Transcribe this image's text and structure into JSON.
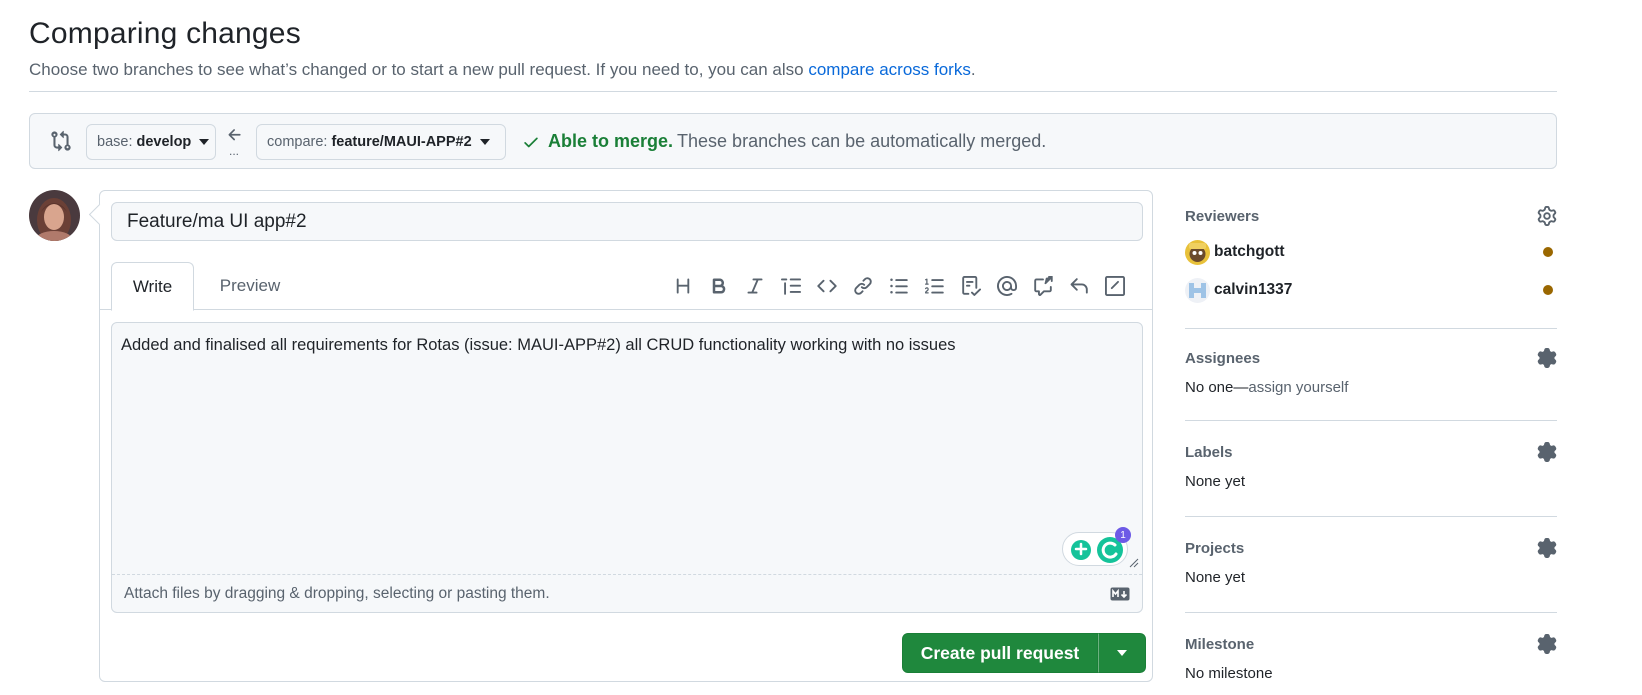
{
  "header": {
    "title": "Comparing changes",
    "subtitle": "Choose two branches to see what’s changed or to start a new pull request. If you need to, you can also",
    "subtitle_link": "compare across forks",
    "subtitle_end": "."
  },
  "compare": {
    "base_prefix": "base:",
    "base_branch": "develop",
    "compare_prefix": "compare:",
    "compare_branch": "feature/MAUI-APP#2",
    "dots": "...",
    "merge_ok": "Able to merge.",
    "merge_text": "These branches can be automatically merged.",
    "colors": {
      "ok": "#1a7f37"
    }
  },
  "editor": {
    "title_value": "Feature/ma UI app#2",
    "tabs": {
      "write": "Write",
      "preview": "Preview"
    },
    "toolbar_icons": [
      "heading-icon",
      "bold-icon",
      "italic-icon",
      "quote-icon",
      "code-icon",
      "link-icon",
      "unordered-list-icon",
      "ordered-list-icon",
      "task-list-icon",
      "mention-icon",
      "cross-reference-icon",
      "reply-icon",
      "slash-commands-icon"
    ],
    "body_value": "Added and finalised all requirements for Rotas (issue: MAUI-APP#2) all CRUD functionality working with no issues",
    "grammarly_badge": "1",
    "attach_text": "Attach files by dragging & dropping, selecting or pasting them.",
    "create_label": "Create pull request",
    "colors": {
      "primary": "#1f883d"
    }
  },
  "sidebar": {
    "reviewers": {
      "label": "Reviewers",
      "items": [
        {
          "name": "batchgott"
        },
        {
          "name": "calvin1337"
        }
      ]
    },
    "assignees": {
      "label": "Assignees",
      "value": "No one—",
      "action": "assign yourself"
    },
    "labels": {
      "label": "Labels",
      "value": "None yet"
    },
    "projects": {
      "label": "Projects",
      "value": "None yet"
    },
    "milestone": {
      "label": "Milestone",
      "value": "No milestone"
    },
    "colors": {
      "pending": "#9a6700"
    }
  }
}
